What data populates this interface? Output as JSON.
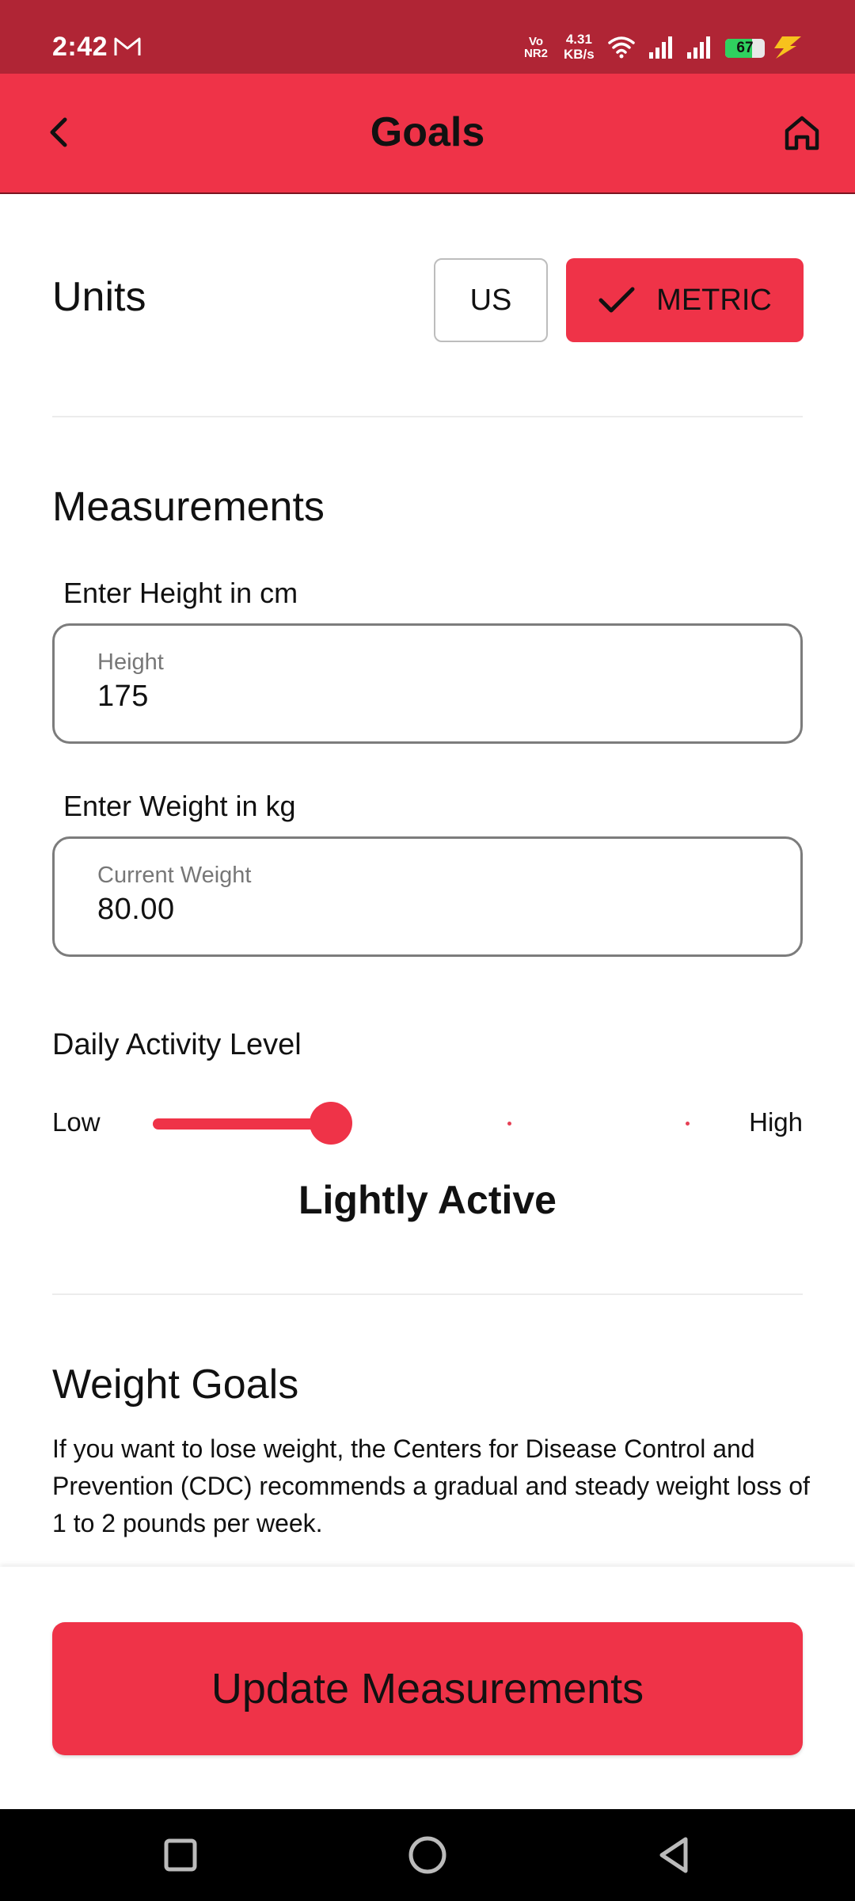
{
  "status_bar": {
    "time": "2:42",
    "notification_icon": "gmail-icon",
    "volte_line1": "Vo",
    "volte_line2": "NR2",
    "speed_line1": "4.31",
    "speed_line2": "KB/s",
    "battery_percent": "67",
    "battery_level": 0.67
  },
  "app_bar": {
    "title": "Goals",
    "back_icon": "chevron-left-icon",
    "home_icon": "home-icon"
  },
  "units": {
    "label": "Units",
    "options": [
      "US",
      "METRIC"
    ],
    "selected": "METRIC"
  },
  "measurements": {
    "title": "Measurements",
    "height": {
      "prompt": "Enter Height in cm",
      "label": "Height",
      "value": "175"
    },
    "weight": {
      "prompt": "Enter Weight in kg",
      "label": "Current Weight",
      "value": "80.00"
    }
  },
  "activity": {
    "label": "Daily Activity Level",
    "low_label": "Low",
    "high_label": "High",
    "level_index": 1,
    "level_count": 3,
    "value_label": "Lightly Active"
  },
  "weight_goals": {
    "title": "Weight Goals",
    "description": "If you want to lose weight, the Centers for Disease Control and Prevention (CDC) recommends a gradual and steady weight loss of 1 to 2 pounds per week."
  },
  "update_button": {
    "label": "Update Measurements"
  },
  "colors": {
    "status_bar": "#b02535",
    "accent": "#ef3348"
  }
}
